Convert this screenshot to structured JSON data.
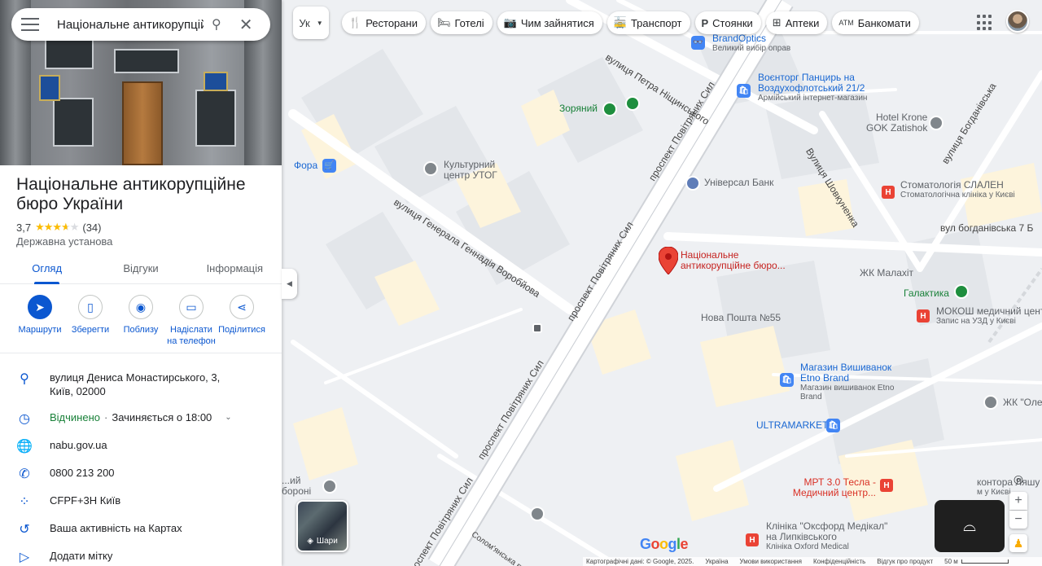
{
  "search": {
    "value": "Національне антикорупційне"
  },
  "place": {
    "title": "Національне антикорупційне бюро України",
    "rating": "3,7",
    "rating_value": 3.7,
    "reviews_count": "(34)",
    "category": "Державна установа"
  },
  "tabs": [
    {
      "label": "Огляд",
      "active": true
    },
    {
      "label": "Відгуки",
      "active": false
    },
    {
      "label": "Інформація",
      "active": false
    }
  ],
  "actions": [
    {
      "label": "Маршрути",
      "icon": "directions-icon"
    },
    {
      "label": "Зберегти",
      "icon": "bookmark-icon"
    },
    {
      "label": "Поблизу",
      "icon": "nearby-icon"
    },
    {
      "label": "Надіслати на телефон",
      "icon": "send-to-phone-icon"
    },
    {
      "label": "Поділитися",
      "icon": "share-icon"
    }
  ],
  "info": {
    "address": "вулиця Дениса Монастирського, 3, Київ, 02000",
    "hours_status": "Відчинено",
    "hours_close": "Зачиняється о 18:00",
    "website": "nabu.gov.ua",
    "phone": "0800 213 200",
    "plus_code": "CFPF+3H Київ",
    "activity": "Ваша активність на Картах",
    "label_action": "Додати мітку"
  },
  "map": {
    "language_button": "Ук",
    "chips": [
      {
        "label": "Ресторани",
        "icon": "restaurant-icon"
      },
      {
        "label": "Готелі",
        "icon": "hotel-icon"
      },
      {
        "label": "Чим зайнятися",
        "icon": "camera-icon"
      },
      {
        "label": "Транспорт",
        "icon": "transit-icon"
      },
      {
        "label": "Стоянки",
        "icon": "parking-icon"
      },
      {
        "label": "Аптеки",
        "icon": "pharmacy-icon"
      },
      {
        "label": "Банкомати",
        "icon": "atm-icon"
      }
    ],
    "selected_marker": {
      "line1": "Національне",
      "line2": "антикорупційне бюро..."
    },
    "pois": {
      "brandoptics": {
        "name": "BrandOptics",
        "sub": "Великий вибір оправ"
      },
      "voentorg": {
        "name": "Воєнторг Панцирь на Воздухофлотський 21/2",
        "sub": "Армійський інтернет-магазин"
      },
      "hotel_krone": {
        "name": "Hotel Krone",
        "sub": "GOK Zatishok"
      },
      "zoryanyi": {
        "name": "Зоряний"
      },
      "fora": {
        "name": "Фора"
      },
      "utog": {
        "name": "Культурний центр УТОГ"
      },
      "universal_bank": {
        "name": "Універсал Банк"
      },
      "slalen": {
        "name": "Стоматологія СЛАЛЕН",
        "sub": "Стоматологічна клініка у Києві"
      },
      "malakhit": {
        "name": "ЖК Малахіт"
      },
      "galaktyka": {
        "name": "Галактика"
      },
      "mokosh": {
        "name": "МОКОШ медичний цент",
        "sub": "Запис на УЗД у Києві"
      },
      "nova_poshta": {
        "name": "Нова Пошта №55"
      },
      "vyshyvanky": {
        "name": "Магазин Вишиванок Etno Brand",
        "sub": "Магазин вишиванок Etno Brand"
      },
      "ultramarket": {
        "name": "ULTRAMARKET"
      },
      "zhk_olen": {
        "name": "ЖК \"Оле"
      },
      "mrt": {
        "name": "МРТ 3.0 Тесла - Медичний центр..."
      },
      "lyashu": {
        "name": "контора Ляшу",
        "sub": "м у Києві"
      },
      "oxford": {
        "name": "Клініка \"Оксфорд Медікал\" на Липківського",
        "sub": "Клініка Oxford Medical"
      },
      "boronyi": {
        "name": "...ий",
        "sub": "боронi"
      }
    },
    "roads": {
      "petra": "вулиця Петра Ніщинського",
      "pov_sil_1": "проспект Повітряних Сил",
      "pov_sil_2": "проспект Повітряних Сил",
      "pov_sil_3": "проспект Повітряних Сил",
      "pov_sil_4": "проспект Повітряних Сил",
      "vorobyova": "вулиця Генерала Геннадія Воробйова",
      "shovkunenka": "Вулиця Шовкуненка",
      "bogdanivska": "вулиця Богданівська",
      "bogdanivska_7": "вул богданівська 7 Б",
      "solomyanska": "Солом'янська вулиця"
    },
    "layers_label": "Шари",
    "google_logo": "Google",
    "footer": {
      "map_data": "Картографічні дані: © Google, 2025.",
      "country": "Україна",
      "terms": "Умови використання",
      "privacy": "Конфіденційність",
      "feedback": "Відгук про продукт",
      "scale": "50 м"
    }
  }
}
